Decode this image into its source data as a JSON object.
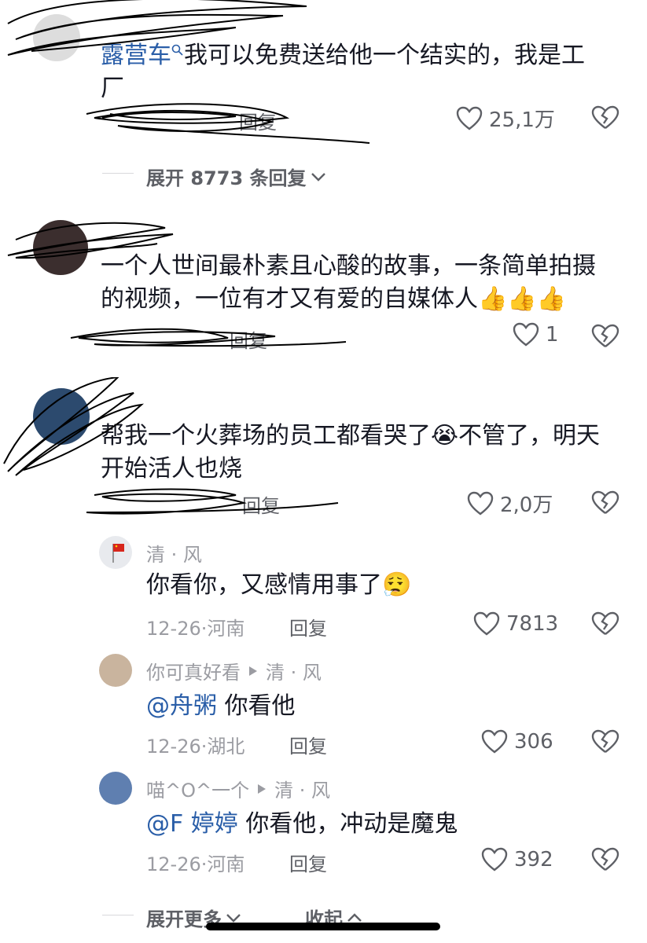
{
  "comments": [
    {
      "username": "",
      "location": "",
      "tag_text": "露营车",
      "text": "我可以免费送给他一个结实的，我是工厂",
      "reply_label": "回复",
      "likes": "25,1万",
      "expand_label": "展开 8773 条回复"
    },
    {
      "text": "一个人世间最朴素且心酸的故事，一条简单拍摄的视频，一位有才又有爱的自媒体人👍👍👍",
      "reply_label": "回复",
      "likes": "1"
    },
    {
      "text": "帮我一个火葬场的员工都看哭了😭不管了，明天开始活人也烧",
      "reply_label": "回复",
      "likes": "2,0万"
    }
  ],
  "replies": [
    {
      "name": "清 · 风",
      "arrow_to": "",
      "mention": "",
      "text": "你看你，又感情用事了😮‍💨",
      "date": "12-26",
      "place": "河南",
      "reply_label": "回复",
      "likes": "7813"
    },
    {
      "name": "你可真好看",
      "arrow_to": "清 · 风",
      "mention": "@舟粥",
      "text": "你看他",
      "date": "12-26",
      "place": "湖北",
      "reply_label": "回复",
      "likes": "306"
    },
    {
      "name": "喵^O^一个",
      "arrow_to": "清 · 风",
      "mention": "@F 婷婷",
      "text": "你看他，冲动是魔鬼",
      "date": "12-26",
      "place": "河南",
      "reply_label": "回复",
      "likes": "392"
    }
  ],
  "footer": {
    "expand_more": "展开更多",
    "collapse": "收起"
  },
  "colors": {
    "mention": "#2a5ea8",
    "text": "#161823",
    "meta": "#9b9ca2"
  },
  "icons": [
    "heart-icon",
    "broken-heart-icon",
    "chevron-down-icon",
    "chevron-up-icon",
    "search-icon"
  ]
}
